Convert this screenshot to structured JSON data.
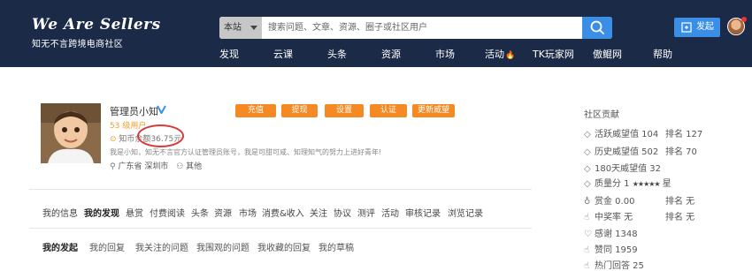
{
  "header": {
    "logo_title": "We Are Sellers",
    "logo_subtitle": "知无不言跨境电商社区",
    "search_scope": "本站",
    "search_placeholder": "搜索问题、文章、资源、圈子或社区用户",
    "post_button": "发起",
    "nav": [
      "发现",
      "云课",
      "头条",
      "资源",
      "市场",
      "活动",
      "TK玩家网",
      "傲鲲网",
      "帮助"
    ]
  },
  "profile": {
    "username": "管理员小知",
    "level": "53 级用户",
    "balance_label": "知币余额",
    "balance_value": "36.75元",
    "bio": "我是小知，知无不言官方认证管理员账号，我是可甜可咸、知理知气的努力上进好青年!",
    "location": "广东省 深圳市",
    "gender": "其他",
    "actions": [
      "充值",
      "提现",
      "设置",
      "认证",
      "更新威望"
    ]
  },
  "tabs": [
    "我的信息",
    "我的发现",
    "悬赏",
    "付费阅读",
    "头条",
    "资源",
    "市场",
    "消费&收入",
    "关注",
    "协议",
    "测评",
    "活动",
    "审核记录",
    "浏览记录"
  ],
  "active_tab": "我的发现",
  "subtabs": [
    "我的发起",
    "我的回复",
    "我关注的问题",
    "我围观的问题",
    "我收藏的回复",
    "我的草稿"
  ],
  "active_subtab": "我的发起",
  "sidebar": {
    "title": "社区贡献",
    "rows": [
      {
        "icon": "diamond-icon",
        "label": "活跃威望值 104",
        "rank": "排名 127"
      },
      {
        "icon": "diamond-icon",
        "label": "历史威望值 502",
        "rank": "排名 70"
      },
      {
        "icon": "diamond-icon",
        "label": "180天威望值 32",
        "rank": ""
      },
      {
        "icon": "diamond-icon",
        "label": "质量分 1",
        "rank": "",
        "stars": "★★★★★",
        "suffix": "星"
      },
      {
        "icon": "coin-icon",
        "label": "赏金 0.00",
        "rank": "排名 无"
      },
      {
        "icon": "hand-icon",
        "label": "中奖率 无",
        "rank": "排名 无"
      },
      {
        "icon": "heart-icon",
        "label": "感谢 1348",
        "rank": ""
      },
      {
        "icon": "thumb-icon",
        "label": "赞同 1959",
        "rank": ""
      },
      {
        "icon": "thumb-icon",
        "label": "热门回答 25",
        "rank": ""
      }
    ]
  },
  "colors": {
    "topbar": "#1b2a47",
    "accent": "#3a8ee6",
    "orange": "#f58a24",
    "annotation": "#d83a3a"
  }
}
